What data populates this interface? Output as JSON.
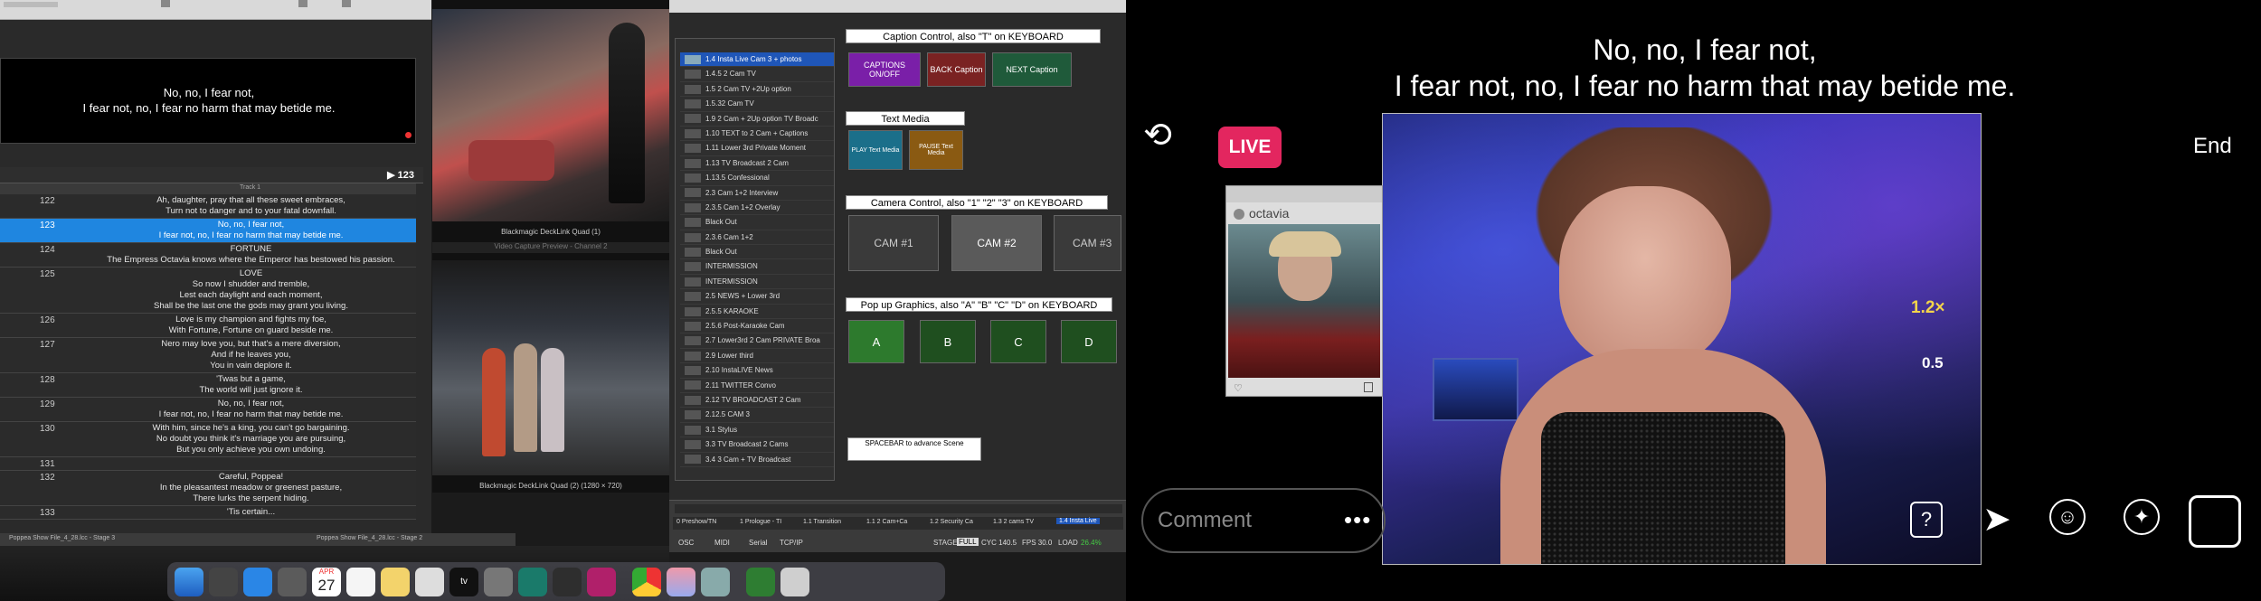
{
  "captions_app": {
    "preview_lines": [
      "No, no, I fear not,",
      "I fear not, no, I fear no harm that may betide me."
    ],
    "current_cue": "▶ 123",
    "column_header": "Track 1",
    "cues": [
      {
        "num": "122",
        "lines": [
          "Ah, daughter, pray that all these sweet embraces,",
          "Turn not to danger and to your fatal downfall."
        ]
      },
      {
        "num": "123",
        "lines": [
          "No, no, I fear not,",
          "I fear not, no, I fear no harm that may betide me."
        ],
        "selected": true
      },
      {
        "num": "124",
        "lines": [
          "FORTUNE",
          "The Empress Octavia knows where the Emperor has bestowed his passion."
        ]
      },
      {
        "num": "125",
        "lines": [
          "LOVE",
          "So now I shudder and tremble,",
          "Lest each daylight and each moment,",
          "Shall be the last one the gods may grant you living."
        ]
      },
      {
        "num": "126",
        "lines": [
          "Love is my champion and fights my foe,",
          "With Fortune, Fortune on guard beside me."
        ]
      },
      {
        "num": "127",
        "lines": [
          "Nero may love you, but that's a mere diversion,",
          "And if he leaves you,",
          "You in vain deplore it."
        ]
      },
      {
        "num": "128",
        "lines": [
          "'Twas but a game,",
          "The world will just ignore it."
        ]
      },
      {
        "num": "129",
        "lines": [
          "No, no, I fear not,",
          "I fear not, no, I fear no harm that may betide me."
        ]
      },
      {
        "num": "130",
        "lines": [
          "With him, since he's a king, you can't go bargaining.",
          "No doubt you think it's marriage you are pursuing,",
          "But you only achieve you own undoing."
        ]
      },
      {
        "num": "131",
        "lines": [
          ""
        ]
      },
      {
        "num": "132",
        "lines": [
          "Careful, Poppea!",
          "In the pleasantest meadow or greenest pasture,",
          "There lurks the serpent hiding."
        ]
      },
      {
        "num": "133",
        "lines": [
          "'Tis certain..."
        ]
      }
    ],
    "bottom_tabs": [
      "Poppea Show File_4_28.lcc - Stage 3",
      "Poppea Show File_4_28.lcc - Stage 2"
    ]
  },
  "video_preview": {
    "label_1": "Blackmagic DeckLink Quad (1)",
    "channel_label": "Video Capture Preview - Channel 2",
    "label_2": "Blackmagic DeckLink Quad (2) (1280 × 720)"
  },
  "controller": {
    "items": [
      "1.4 Insta Live Cam 3 + photos",
      "1.4.5 2 Cam TV",
      "1.5 2 Cam TV +2Up option",
      "1.5.32 Cam TV",
      "1.9 2 Cam + 2Up option TV Broadc",
      "1.10 TEXT to 2 Cam + Captions",
      "1.11 Lower 3rd Private Moment",
      "1.13 TV Broadcast 2 Cam",
      "1.13.5 Confessional",
      "2.3 Cam 1+2 Interview",
      "2.3.5 Cam 1+2 Overlay",
      "Black Out",
      "2.3.6 Cam 1+2",
      "Black Out",
      "INTERMISSION",
      "INTERMISSION",
      "2.5 NEWS + Lower 3rd",
      "2.5.5 KARAOKE",
      "2.5.6 Post-Karaoke Cam",
      "2.7 Lower3rd 2 Cam PRIVATE Broa",
      "2.9 Lower third",
      "2.10 InstaLIVE News",
      "2.11 TWITTER Convo",
      "2.12 TV BROADCAST 2 Cam",
      "2.12.5 CAM 3",
      "3.1 Stylus",
      "3.3 TV Broadcast  2 Cams",
      "3.4  3 Cam + TV Broadcast"
    ],
    "caption_header": "Caption Control, also \"T\" on KEYBOARD",
    "captions_onoff": "CAPTIONS ON/OFF",
    "back_caption": "BACK Caption",
    "next_caption": "NEXT Caption",
    "text_media_header": "Text Media",
    "play_text": "PLAY Text Media",
    "pause_text": "PAUSE Text Media",
    "camera_header": "Camera Control, also \"1\" \"2\" \"3\" on KEYBOARD",
    "cams": [
      "CAM #1",
      "CAM #2",
      "CAM #3"
    ],
    "popup_header": "Pop up Graphics, also \"A\" \"B\" \"C\" \"D\" on KEYBOARD",
    "popups": [
      "A",
      "B",
      "C",
      "D"
    ],
    "spacebar_note": "SPACEBAR to advance Scene",
    "status_tabs": [
      "0 Preshow/TN",
      "1 Prologue - TI",
      "1.1 Transition",
      "1.1 2 Cam+Ca",
      "1.2 Security Ca",
      "1.3 2 cams TV",
      "1.4 Insta Live"
    ],
    "status_bar": [
      "OSC",
      "MIDI",
      "Serial",
      "TCP/IP",
      "STAGE",
      "FULL",
      "CYC 140.5",
      "FPS 30.0",
      "LOAD",
      "26.4%"
    ],
    "accent_colors": {
      "purple": "#7a1fa8",
      "red": "#7a2222",
      "green": "#1f5a3a",
      "teal": "#1b6f8a",
      "orange": "#8a5a12",
      "popup_green": "#2d7a2d"
    }
  },
  "dock": {
    "calendar_month": "APR",
    "calendar_day": "27"
  },
  "instagram": {
    "subtitle_lines": [
      "No, no, I fear not,",
      "I fear not, no, I fear no harm that may betide me."
    ],
    "live_badge": "LIVE",
    "end_label": "End",
    "zoom_main": "1.2×",
    "zoom_alt": "0.5",
    "guest_name": "octavia",
    "comment_placeholder": "Comment",
    "colors": {
      "live": "#e3265f"
    }
  }
}
